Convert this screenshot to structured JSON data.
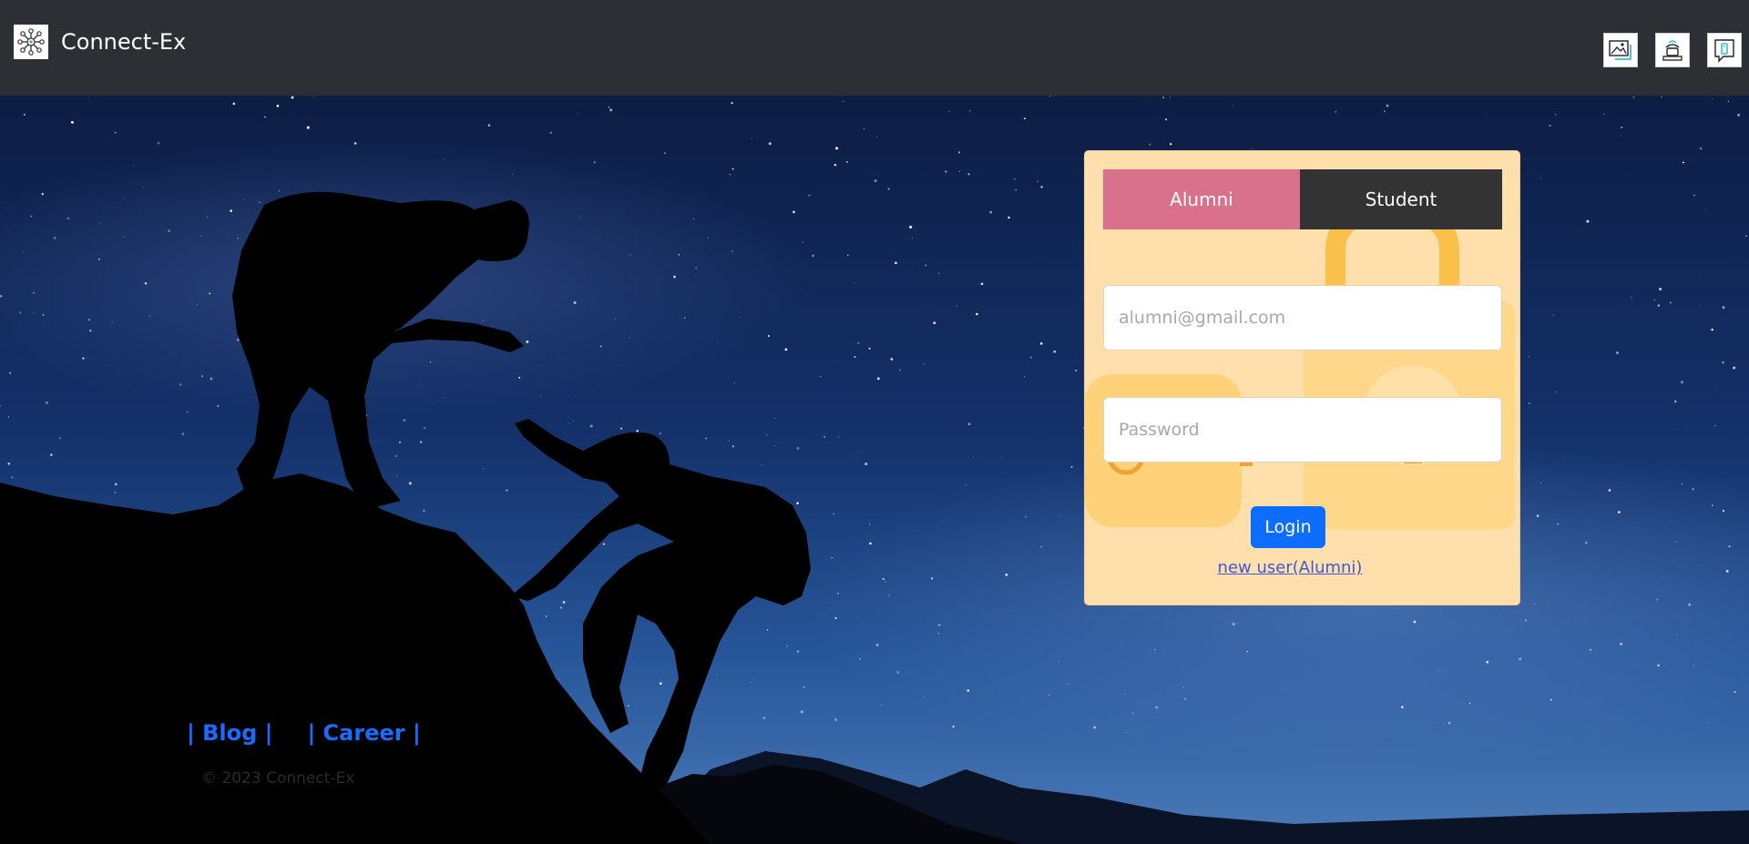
{
  "navbar": {
    "brand": "Connect-Ex",
    "logo_icon": "network-hub-icon",
    "icons": [
      "gallery-icon",
      "contact-phone-icon",
      "info-icon"
    ]
  },
  "login": {
    "tabs": [
      {
        "label": "Alumni",
        "active": true,
        "color": "#d9708c"
      },
      {
        "label": "Student",
        "active": false,
        "color": "#333333"
      }
    ],
    "email_placeholder": "alumni@gmail.com",
    "password_placeholder": "Password",
    "login_label": "Login",
    "register_link": "new user(Alumni)",
    "card_color": "#ffe0ac"
  },
  "footer": {
    "links": [
      {
        "label": "| Blog |"
      },
      {
        "label": "| Career |"
      }
    ],
    "copyright": "© 2023 Connect-Ex"
  },
  "colors": {
    "navbar": "#2c2f33",
    "primary_button": "#0d6efd",
    "link": "#1a6cff"
  }
}
